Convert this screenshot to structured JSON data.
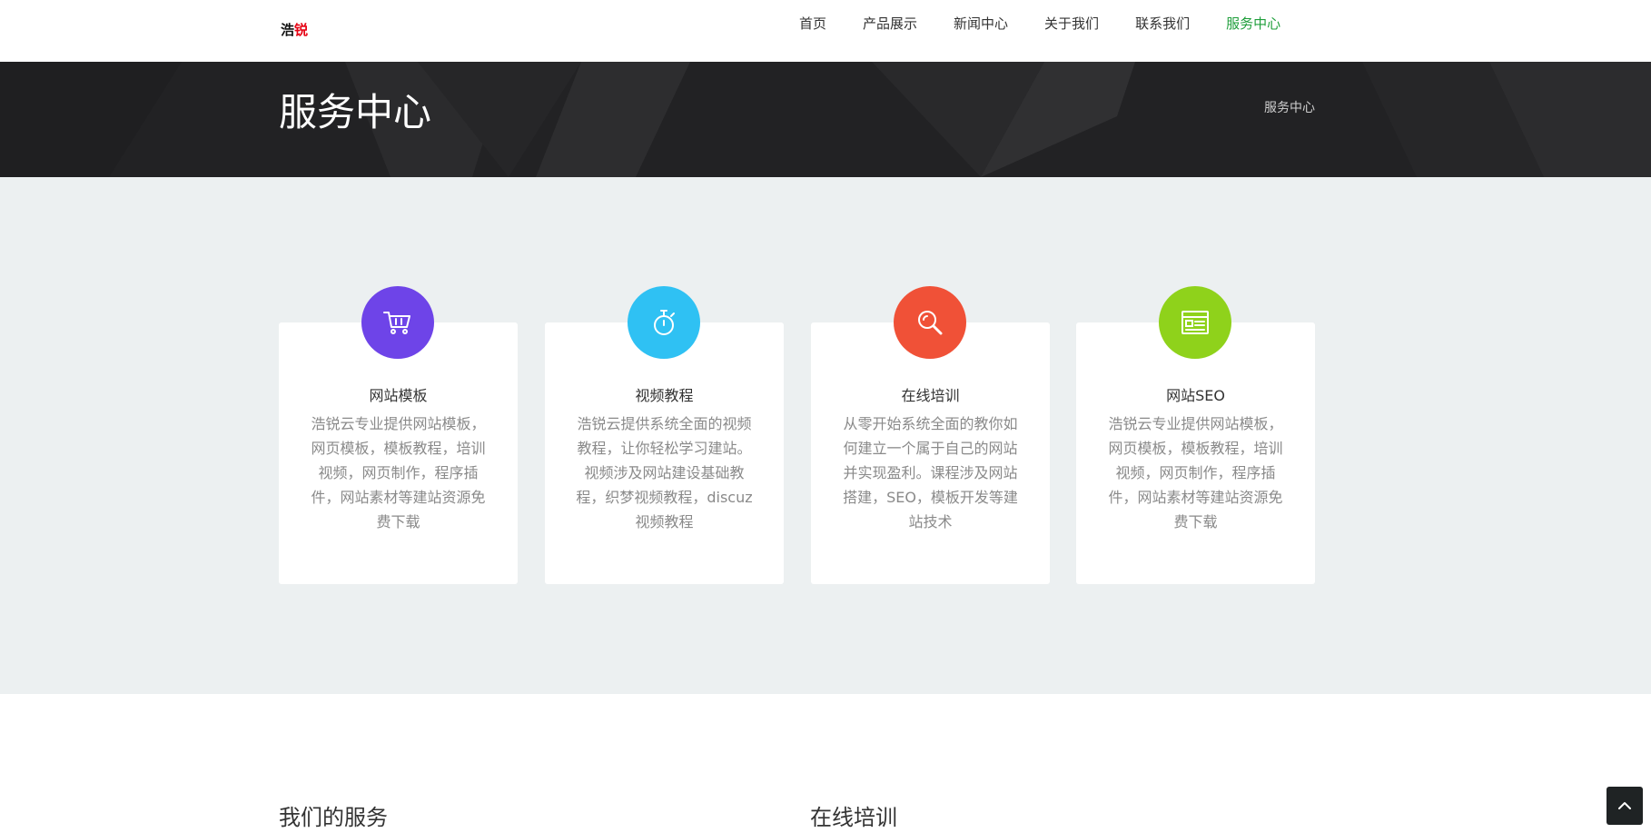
{
  "logo": {
    "part1": "浩",
    "part2": "锐"
  },
  "nav": {
    "items": [
      {
        "label": "首页"
      },
      {
        "label": "产品展示"
      },
      {
        "label": "新闻中心"
      },
      {
        "label": "关于我们"
      },
      {
        "label": "联系我们"
      },
      {
        "label": "服务中心"
      }
    ],
    "active_index": 5
  },
  "banner": {
    "title": "服务中心",
    "breadcrumb": "服务中心"
  },
  "services": [
    {
      "icon": "cart-icon",
      "color": "#6e44e8",
      "title": "网站模板",
      "desc": "浩锐云专业提供网站模板，网页模板，模板教程，培训视频，网页制作，程序插件，网站素材等建站资源免费下载"
    },
    {
      "icon": "stopwatch-icon",
      "color": "#2fc1f3",
      "title": "视频教程",
      "desc": "浩锐云提供系统全面的视频教程，让你轻松学习建站。视频涉及网站建设基础教程，织梦视频教程，discuz视频教程"
    },
    {
      "icon": "search-icon",
      "color": "#f05137",
      "title": "在线培训",
      "desc": "从零开始系统全面的教你如何建立一个属于自己的网站并实现盈利。课程涉及网站搭建，SEO，模板开发等建站技术"
    },
    {
      "icon": "newspaper-icon",
      "color": "#8fd21b",
      "title": "网站SEO",
      "desc": "浩锐云专业提供网站模板，网页模板，模板教程，培训视频，网页制作，程序插件，网站素材等建站资源免费下载"
    }
  ],
  "bottom": {
    "left_title": "我们的服务",
    "right_title": "在线培训"
  },
  "back_to_top": {
    "icon": "chevron-up-icon"
  }
}
